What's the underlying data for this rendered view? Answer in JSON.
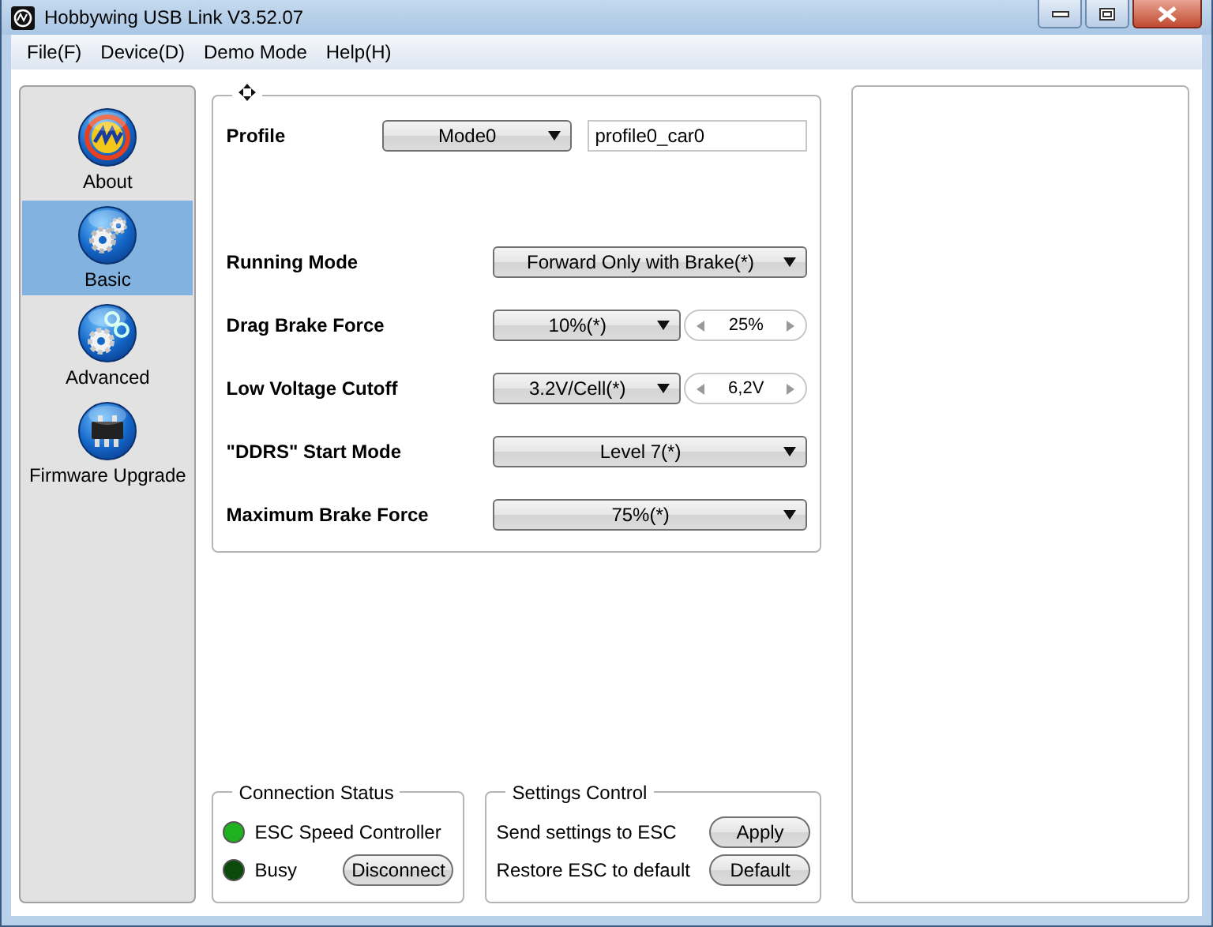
{
  "window": {
    "title": "Hobbywing USB Link V3.52.07"
  },
  "menu": [
    "File(F)",
    "Device(D)",
    "Demo Mode",
    "Help(H)"
  ],
  "sidebar": {
    "items": [
      {
        "label": "About",
        "kind": "about",
        "selected": false
      },
      {
        "label": "Basic",
        "kind": "basic",
        "selected": true
      },
      {
        "label": "Advanced",
        "kind": "advanced",
        "selected": false
      },
      {
        "label": "Firmware Upgrade",
        "kind": "firmware",
        "selected": false
      }
    ]
  },
  "profile": {
    "label": "Profile",
    "mode": "Mode0",
    "name": "profile0_car0"
  },
  "settings": [
    {
      "label": "Running Mode",
      "kind": "dropdown",
      "value": "Forward Only with Brake(*)"
    },
    {
      "label": "Drag Brake Force",
      "kind": "dropdown-spinner",
      "value": "10%(*)",
      "spinner": "25%"
    },
    {
      "label": "Low Voltage Cutoff",
      "kind": "dropdown-spinner",
      "value": "3.2V/Cell(*)",
      "spinner": "6,2V"
    },
    {
      "label": "\"DDRS\" Start Mode",
      "kind": "dropdown",
      "value": "Level 7(*)"
    },
    {
      "label": "Maximum Brake Force",
      "kind": "dropdown",
      "value": "75%(*)"
    }
  ],
  "connection_status": {
    "title": "Connection Status",
    "indicators": [
      {
        "label": "ESC Speed Controller",
        "color": "#1fb11f"
      },
      {
        "label": "Busy",
        "color": "#0b4a0b"
      }
    ],
    "button": "Disconnect"
  },
  "settings_control": {
    "title": "Settings Control",
    "rows": [
      {
        "label": "Send settings to ESC",
        "button": "Apply"
      },
      {
        "label": "Restore ESC to default",
        "button": "Default"
      }
    ]
  }
}
